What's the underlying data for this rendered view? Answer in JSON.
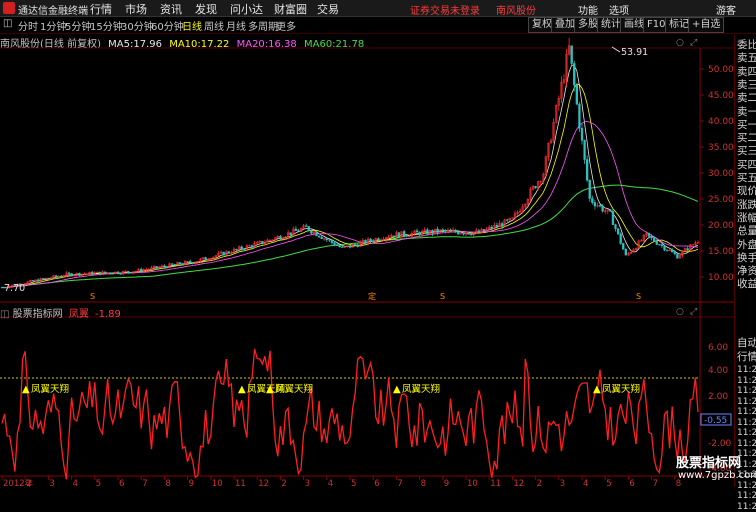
{
  "menubar": {
    "app_title": "通达信金融终端",
    "items": [
      "行情",
      "市场",
      "资讯",
      "发现",
      "问小达",
      "财富圈",
      "交易"
    ],
    "warning": "证券交易未登录",
    "stock_name": "南风股份",
    "right_items": [
      "功能",
      "选项",
      "游客"
    ]
  },
  "periods": [
    "分时",
    "1分钟",
    "5分钟",
    "15分钟",
    "30分钟",
    "60分钟",
    "日线",
    "周线",
    "月线",
    "多周期",
    "更多"
  ],
  "active_period": "日线",
  "toolbar": [
    "复权",
    "叠加",
    "多股",
    "统计",
    "画线",
    "F10",
    "标记",
    "+自选"
  ],
  "main": {
    "title": "南风股份(日线 前复权)",
    "ma": [
      {
        "label": "MA5:",
        "value": "17.96",
        "color": "#e8e8e8"
      },
      {
        "label": "MA10:",
        "value": "17.22",
        "color": "#ffff00"
      },
      {
        "label": "MA20:",
        "value": "16.38",
        "color": "#ff55ff"
      },
      {
        "label": "MA60:",
        "value": "21.78",
        "color": "#44dd44"
      }
    ],
    "y_ticks": [
      "50.00",
      "45.00",
      "40.00",
      "35.00",
      "30.00",
      "25.00",
      "20.00",
      "15.00",
      "10.00"
    ],
    "high_label": "53.91",
    "low_label": "7.70",
    "markers": [
      "S",
      "定",
      "S",
      "S"
    ]
  },
  "sub": {
    "site": "股票指标网",
    "name": "凤翼",
    "value": "-1.89",
    "y_ticks": [
      "6.00",
      "4.00",
      "2.00",
      "-2.00",
      "-4.00"
    ],
    "current_label": "-0.55",
    "signals": [
      "凤翼天翔",
      "凤翼天翔",
      "凤翼天翔",
      "凤翼天翔",
      "凤翼天翔"
    ]
  },
  "x_axis": [
    "2012年",
    "2",
    "3",
    "4",
    "5",
    "6",
    "7",
    "8",
    "9",
    "10",
    "11",
    "12",
    "2",
    "3",
    "4",
    "5",
    "6",
    "7",
    "8",
    "9",
    "10",
    "11",
    "12",
    "2",
    "3",
    "4",
    "5",
    "6",
    "7",
    "8"
  ],
  "right_panel": {
    "top": [
      "委比",
      "卖五",
      "卖四",
      "卖三",
      "卖二",
      "卖一",
      "买一",
      "买二",
      "买三",
      "买四",
      "买五",
      "现价",
      "涨跌",
      "涨幅",
      "总量",
      "外盘",
      "换手",
      "净资",
      "收益"
    ],
    "mid": [
      "自动",
      "行情"
    ],
    "times": [
      "11:2",
      "11:2",
      "11:2",
      "11:2",
      "11:2",
      "11:2",
      "11:2",
      "11:2",
      "11:2",
      "11:2",
      "11:2",
      "11:2",
      "11:2",
      "11:2"
    ]
  },
  "watermark": {
    "title": "股票指标网",
    "url": "www.7gpzb.com"
  }
}
